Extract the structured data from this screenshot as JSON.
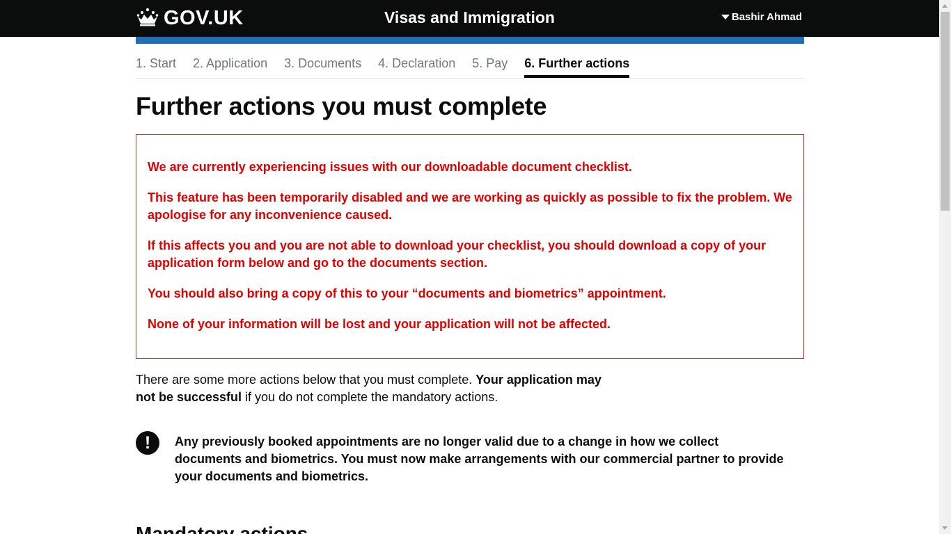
{
  "header": {
    "logo_text": "GOV.UK",
    "service_name": "Visas and Immigration",
    "user_name": "Bashir Ahmad"
  },
  "steps": [
    {
      "label": "1. Start",
      "active": false
    },
    {
      "label": "2. Application",
      "active": false
    },
    {
      "label": "3. Documents",
      "active": false
    },
    {
      "label": "4. Declaration",
      "active": false
    },
    {
      "label": "5. Pay",
      "active": false
    },
    {
      "label": "6. Further actions",
      "active": true
    }
  ],
  "page_title": "Further actions you must complete",
  "alert": {
    "color": "#e00000",
    "border_color": "#d4351c",
    "paragraphs": [
      "We are currently experiencing issues with our downloadable document checklist.",
      "This feature has been temporarily disabled and we are working as quickly as possible to fix the problem. We apologise for any inconvenience caused.",
      "If this affects you and you are not able to download your checklist, you should download a copy of your application form below and go to the documents section.",
      "You should also bring a copy of this to your “documents and biometrics” appointment.",
      "None of your information will be lost and your application will not be affected."
    ]
  },
  "intro": {
    "text_start": "There are some more actions below that you must complete. ",
    "text_bold": "Your application may not be successful",
    "text_end": " if you do not complete the mandatory actions."
  },
  "notice": {
    "icon": "!",
    "icon_name": "warning-icon",
    "text": "Any previously booked appointments are no longer valid due to a change in how we collect documents and biometrics. You must now make arrangements with our commercial partner to provide your documents and biometrics."
  },
  "next_heading": "Mandatory actions",
  "colors": {
    "header_bg": "#0b0c0c",
    "accent_bar": "#1d70b8",
    "text": "#0b0c0c",
    "muted": "#6f777b"
  }
}
